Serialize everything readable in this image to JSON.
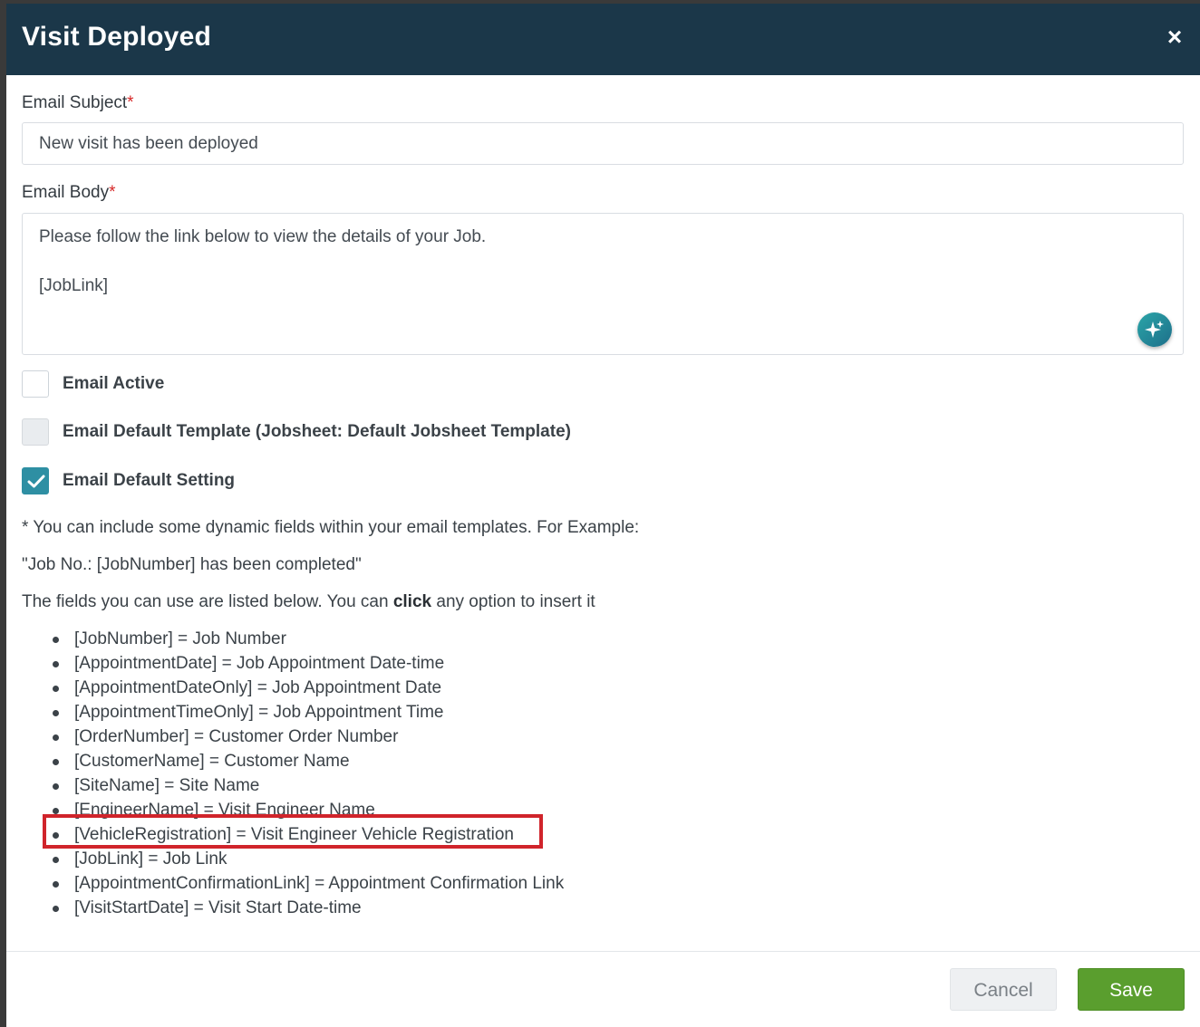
{
  "dialog": {
    "title": "Visit Deployed",
    "close_symbol": "×"
  },
  "email_subject": {
    "label": "Email Subject",
    "required_mark": "*",
    "value": "New visit has been deployed"
  },
  "email_body": {
    "label": "Email Body",
    "required_mark": "*",
    "lines": [
      "Please follow the link below to view the details of your Job.",
      "",
      "[JobLink]"
    ],
    "ai_button_icon": "sparkle-icon"
  },
  "checkboxes": [
    {
      "label": "Email Active",
      "checked": false,
      "disabled": false
    },
    {
      "label": "Email Default Template (Jobsheet: Default Jobsheet Template)",
      "checked": false,
      "disabled": true
    },
    {
      "label": "Email Default Setting",
      "checked": true,
      "disabled": false
    }
  ],
  "info": {
    "line1": "* You can include some dynamic fields within your email templates. For Example:",
    "line2": "\"Job No.: [JobNumber] has been completed\"",
    "line3_before": "The fields you can use are listed below. You can ",
    "line3_bold": "click",
    "line3_after": " any option to insert it"
  },
  "fields": [
    "[JobNumber] = Job Number",
    "[AppointmentDate] = Job Appointment Date-time",
    "[AppointmentDateOnly] = Job Appointment Date",
    "[AppointmentTimeOnly] = Job Appointment Time",
    "[OrderNumber] = Customer Order Number",
    "[CustomerName] = Customer Name",
    "[SiteName] = Site Name",
    "[EngineerName] = Visit Engineer Name",
    "[VehicleRegistration] = Visit Engineer Vehicle Registration",
    "[JobLink] = Job Link",
    "[AppointmentConfirmationLink] = Appointment Confirmation Link",
    "[VisitStartDate] = Visit Start Date-time"
  ],
  "highlighted_field_index": 8,
  "footer": {
    "cancel_label": "Cancel",
    "save_label": "Save"
  },
  "colors": {
    "header_bg": "#1b3749",
    "accent_teal": "#2e8fa3",
    "save_green": "#5a9e2e",
    "highlight_red": "#d0242b",
    "required_red": "#d62828"
  }
}
